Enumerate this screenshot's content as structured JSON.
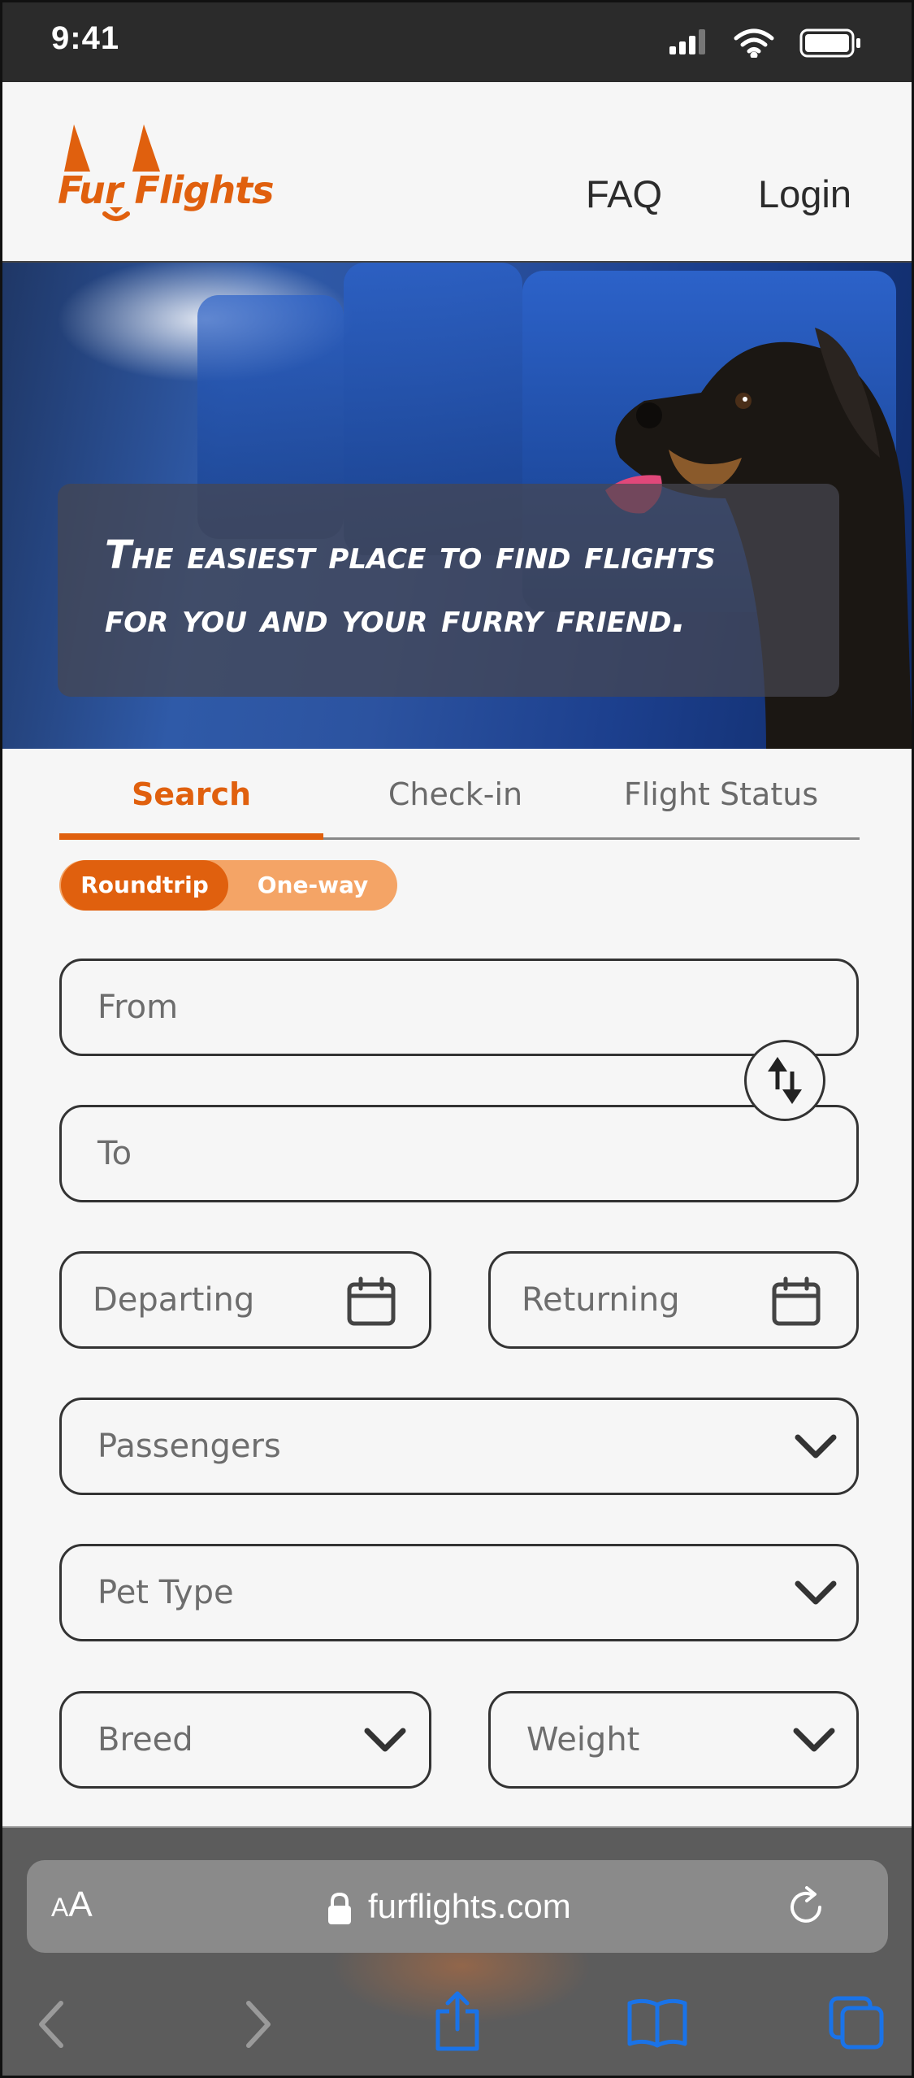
{
  "status_bar": {
    "time": "9:41"
  },
  "header": {
    "logo_text": "Fur Flights",
    "nav": {
      "faq": "FAQ",
      "login": "Login"
    }
  },
  "hero": {
    "caption_line_1": "The easiest place to find flights",
    "caption_line_2": "for you and your furry friend."
  },
  "tabs": [
    {
      "label": "Search",
      "active": true
    },
    {
      "label": "Check-in",
      "active": false
    },
    {
      "label": "Flight Status",
      "active": false
    }
  ],
  "trip_type": {
    "roundtrip": "Roundtrip",
    "oneway": "One-way",
    "selected": "Roundtrip"
  },
  "fields": {
    "from": "From",
    "to": "To",
    "departing": "Departing",
    "returning": "Returning",
    "passengers": "Passengers",
    "pet_type": "Pet Type",
    "breed": "Breed",
    "weight": "Weight"
  },
  "browser": {
    "text_size_small": "A",
    "text_size_big": "A",
    "url": "furflights.com"
  },
  "colors": {
    "accent": "#e0600e",
    "accent_light": "#f4a466",
    "ios_blue": "#1a73e8",
    "text": "#2b2b2b"
  },
  "icons": {
    "swap": "swap-arrows-icon",
    "calendar": "calendar-icon",
    "dropdown": "chevron-down-icon",
    "lock": "lock-icon",
    "reload": "reload-icon",
    "back": "chevron-left-icon",
    "forward": "chevron-right-icon",
    "share": "share-icon",
    "bookmarks": "book-icon",
    "tabs": "tabs-icon"
  }
}
